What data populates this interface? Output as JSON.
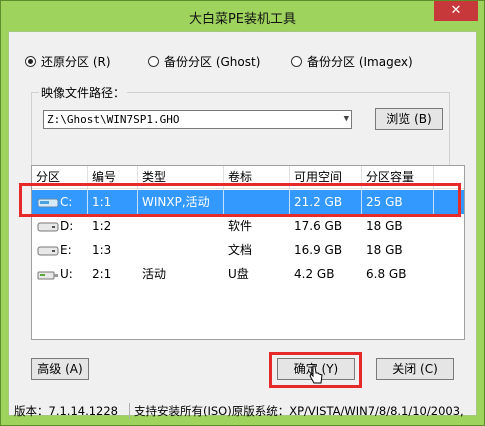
{
  "window": {
    "title": "大白菜PE装机工具",
    "close_symbol": "✕"
  },
  "radios": [
    {
      "label": "还原分区 (R)",
      "checked": true
    },
    {
      "label": "备份分区 (Ghost)",
      "checked": false
    },
    {
      "label": "备份分区 (Imagex)",
      "checked": false
    }
  ],
  "image_path": {
    "label": "映像文件路径：",
    "value": "Z:\\Ghost\\WIN7SP1.GHO",
    "browse_label": "浏览 (B)"
  },
  "table": {
    "columns": [
      "分区",
      "编号",
      "类型",
      "卷标",
      "可用空间",
      "分区容量"
    ],
    "rows": [
      {
        "partition": "C:",
        "number": "1:1",
        "type": "WINXP,活动",
        "label": "",
        "free": "21.2 GB",
        "size": "25 GB",
        "drive_icon": "system-drive-icon"
      },
      {
        "partition": "D:",
        "number": "1:2",
        "type": "",
        "label": "软件",
        "free": "17.6 GB",
        "size": "18 GB",
        "drive_icon": "drive-icon"
      },
      {
        "partition": "E:",
        "number": "1:3",
        "type": "",
        "label": "文档",
        "free": "16.9 GB",
        "size": "18 GB",
        "drive_icon": "drive-icon"
      },
      {
        "partition": "U:",
        "number": "2:1",
        "type": "活动",
        "label": "U盘",
        "free": "4.2 GB",
        "size": "6.8 GB",
        "drive_icon": "usb-drive-icon"
      }
    ]
  },
  "buttons": {
    "advanced": "高级 (A)",
    "ok": "确定 (Y)",
    "close": "关闭 (C)"
  },
  "status": {
    "version": "版本：7.1.14.1228",
    "support": "支持安装所有(ISO)原版系统：XP/VISTA/WIN7/8/8.1/10/2003,"
  },
  "colors": {
    "frame": "#9ed35e",
    "selection": "#3399ff",
    "highlight": "#e62929"
  }
}
